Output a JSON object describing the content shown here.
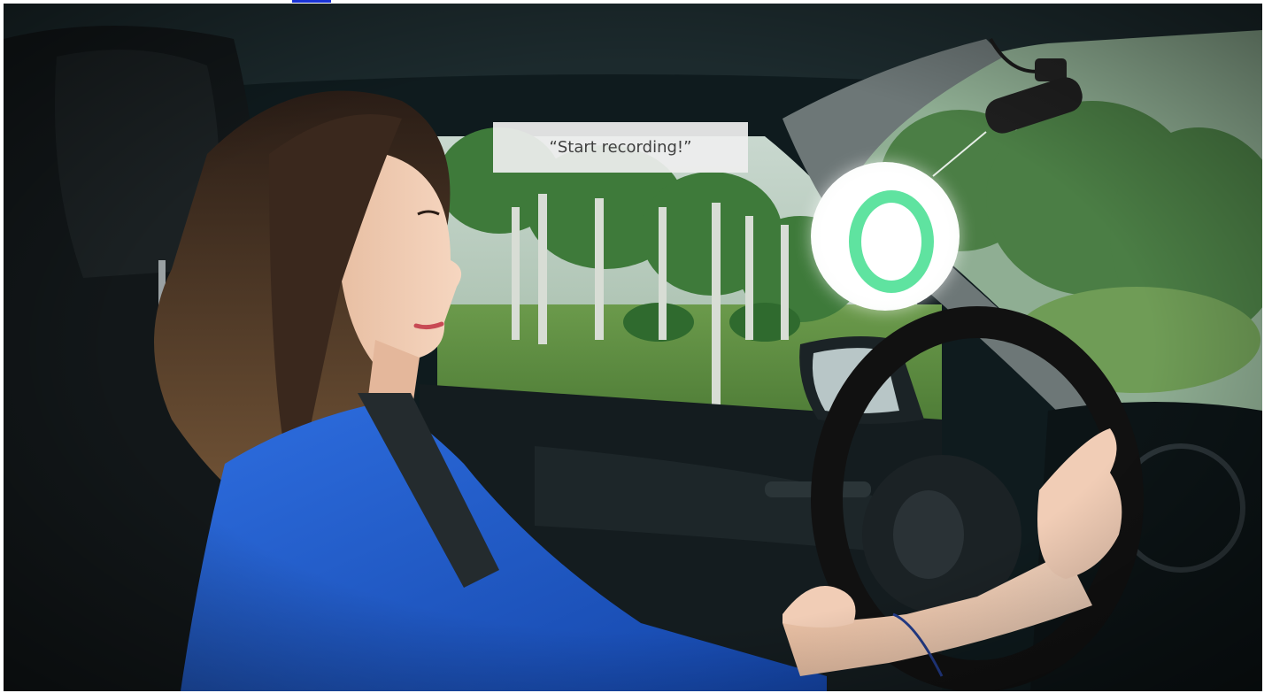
{
  "speech_bubble": {
    "text": "“Start recording!”"
  },
  "indicator": {
    "icon": "recording-ring-icon",
    "ring_color": "#5fe3a0"
  },
  "colors": {
    "link_accent": "#1a33d6",
    "shirt": "#1a55c8",
    "foliage": "#3e7a3a"
  }
}
